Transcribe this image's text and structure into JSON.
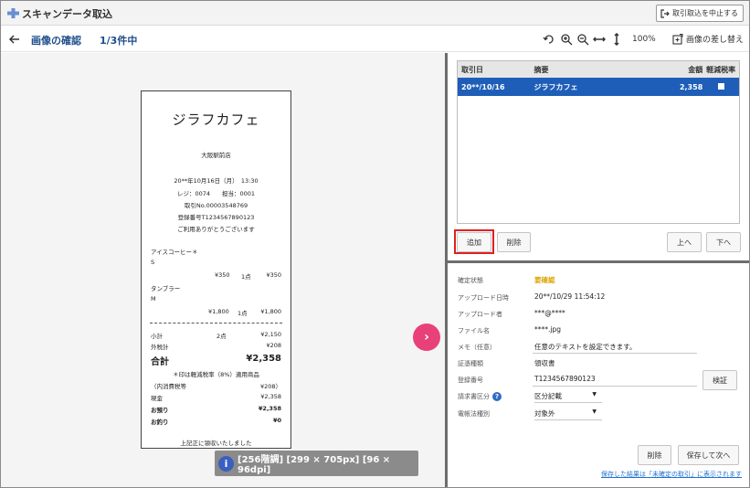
{
  "window": {
    "title": "スキャンデータ取込",
    "stop_button": "取引取込を中止する"
  },
  "header": {
    "title": "画像の確認",
    "page_count": "1/3件中",
    "zoom": "100%",
    "swap_button": "画像の差し替え"
  },
  "receipt": {
    "shop": "ジラフカフェ",
    "branch": "大阪駅前店",
    "datetime": "20**年10月16日（月）　13:30",
    "register": "レジ：0074　　担当：0001",
    "txn_no": "取引No.00003548769",
    "reg_no": "登録番号T1234567890123",
    "thanks": "ご利用ありがとうございます",
    "item1_name": "アイスコーヒー＊",
    "item1_size": "S",
    "item1_price": "¥350",
    "item1_qty": "1点",
    "item1_total": "¥350",
    "item2_name": "タンブラー",
    "item2_size": "M",
    "item2_price": "¥1,800",
    "item2_qty": "1点",
    "item2_total": "¥1,800",
    "subtotal_label": "小計",
    "subtotal_qty": "2点",
    "subtotal_value": "¥2,150",
    "tax_label": "外税計",
    "tax_value": "¥208",
    "total_label": "合計",
    "total_value": "¥2,358",
    "reduced_note": "＊印は軽減税率（8%）適用商品",
    "inner_tax_label": "（内消費税等",
    "inner_tax_value": "¥208）",
    "cash_label": "現金",
    "cash_value": "¥2,358",
    "deposit_label": "お預り",
    "deposit_value": "¥2,358",
    "change_label": "お釣り",
    "change_value": "¥0",
    "footer": "上記正に領収いたしました"
  },
  "image_info": "[256階調] [299 × 705px] [96 × 96dpi]",
  "table": {
    "columns": [
      "取引日",
      "摘要",
      "金額",
      "軽減税率"
    ],
    "rows": [
      {
        "date": "20**/10/16",
        "desc": "ジラフカフェ",
        "amount": "2,358",
        "reduced": false
      }
    ]
  },
  "list_buttons": {
    "add": "追加",
    "delete": "削除",
    "up": "上へ",
    "down": "下へ"
  },
  "details": {
    "status_label": "確定状態",
    "status_value": "要確認",
    "upload_date_label": "アップロード日時",
    "upload_date_value": "20**/10/29 11:54:12",
    "uploader_label": "アップロード者",
    "uploader_value": "***@****",
    "filename_label": "ファイル名",
    "filename_value": "****.jpg",
    "memo_label": "メモ（任意）",
    "memo_value": "任意のテキストを設定できます。",
    "doc_type_label": "証憑種類",
    "doc_type_value": "領収書",
    "reg_no_label": "登録番号",
    "reg_no_value": "T1234567890123",
    "verify_button": "検証",
    "invoice_type_label": "請求書区分",
    "invoice_type_value": "区分記載",
    "ebook_label": "電帳法種別",
    "ebook_value": "対象外",
    "delete_button": "削除",
    "save_next_button": "保存して次へ",
    "footer_link": "保存した結果は「未確定の取引」に表示されます"
  }
}
